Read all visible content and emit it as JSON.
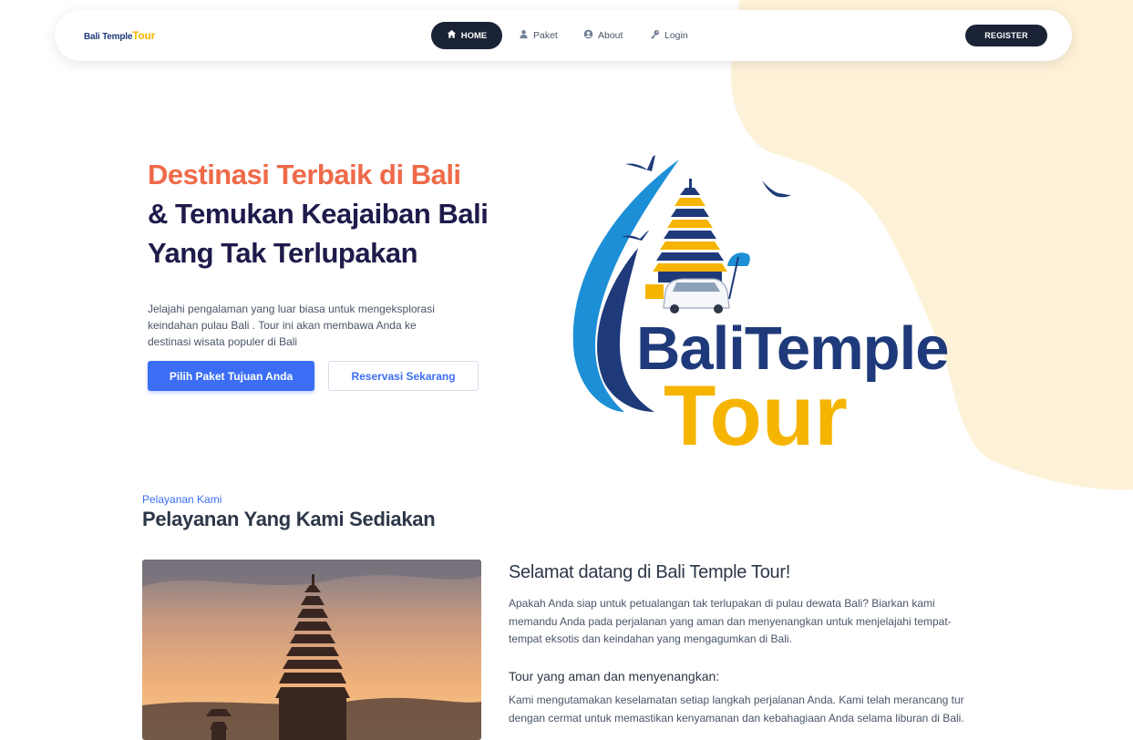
{
  "nav": {
    "brand_part1": "Bali Temple",
    "brand_part2": "Tour",
    "items": [
      {
        "label": "HOME",
        "icon": "home-icon",
        "active": true
      },
      {
        "label": "Paket",
        "icon": "user-icon"
      },
      {
        "label": "About",
        "icon": "user-circle-icon"
      },
      {
        "label": "Login",
        "icon": "key-icon"
      }
    ],
    "register_label": "REGISTER"
  },
  "hero": {
    "line1": "Destinasi Terbaik di Bali",
    "line2": "& Temukan Keajaiban Bali",
    "line3": "Yang Tak Terlupakan",
    "description": "Jelajahi pengalaman yang luar biasa untuk mengeksplorasi keindahan pulau Bali . Tour ini akan membawa Anda ke destinasi wisata populer di Bali",
    "primary_button": "Pilih Paket Tujuan Anda",
    "secondary_button": "Reservasi Sekarang",
    "logo_text_1": "BaliTemple",
    "logo_text_2": "Tour"
  },
  "services": {
    "kicker": "Pelayanan Kami",
    "title": "Pelayanan Yang Kami Sediakan",
    "welcome_title": "Selamat datang di Bali Temple Tour!",
    "welcome_text": "Apakah Anda siap untuk petualangan tak terlupakan di pulau dewata Bali? Biarkan kami memandu Anda pada perjalanan yang aman dan menyenangkan untuk menjelajahi tempat-tempat eksotis dan keindahan yang mengagumkan di Bali.",
    "sub_title": "Tour yang aman dan menyenangkan:",
    "sub_text": "Kami mengutamakan keselamatan setiap langkah perjalanan Anda. Kami telah merancang tur dengan cermat untuk memastikan kenyamanan dan kebahagiaan Anda selama liburan di Bali."
  },
  "colors": {
    "accent_orange": "#ee6a48",
    "navy": "#1e1b4b",
    "primary_blue": "#3b6ef5",
    "logo_yellow": "#f5b400",
    "blob_cream": "#fdf1d8"
  }
}
